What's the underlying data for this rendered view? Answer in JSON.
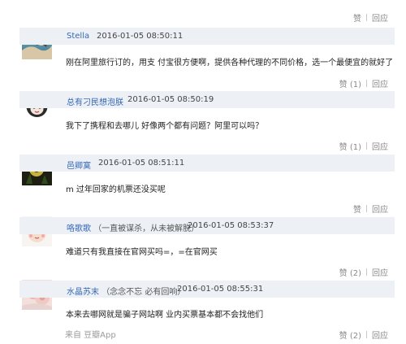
{
  "actions": {
    "like_label": "赞",
    "reply_label": "回应"
  },
  "comments": [
    {
      "user": "Stella",
      "time": "2016-01-05 08:50:11",
      "text": "刚在阿里旅行订的，用支 付宝很方便啊，提供各种代理的不同价格，选一个最便宜的就好了",
      "likes": "(1)"
    },
    {
      "user": "总有刁民想泡朕",
      "time": "2016-01-05 08:50:19",
      "text": "我下了携程和去哪儿 好像两个都有问题？阿里可以吗？",
      "likes": "(1)"
    },
    {
      "user": "邑卿寞",
      "time": "2016-01-05 08:51:11",
      "text": "m 过年回家的机票还没买呢",
      "likes": ""
    },
    {
      "user": "咯歌歌",
      "signature": "（一直被谋杀，从未被解脱）",
      "time": "2016-01-05 08:53:37",
      "text": "难道只有我直接在官网买吗=，=在官网买",
      "likes": "(2)"
    },
    {
      "user": "水晶苏末",
      "signature": "（念念不忘 必有回响）",
      "time": "2016-01-05 08:55:31",
      "text": "本来去哪网就是骗子网站啊 业内买票基本都不会找他们",
      "likes": "(2)"
    }
  ],
  "top_actions": {
    "likes": ""
  },
  "source": "来自 豆瓣App"
}
